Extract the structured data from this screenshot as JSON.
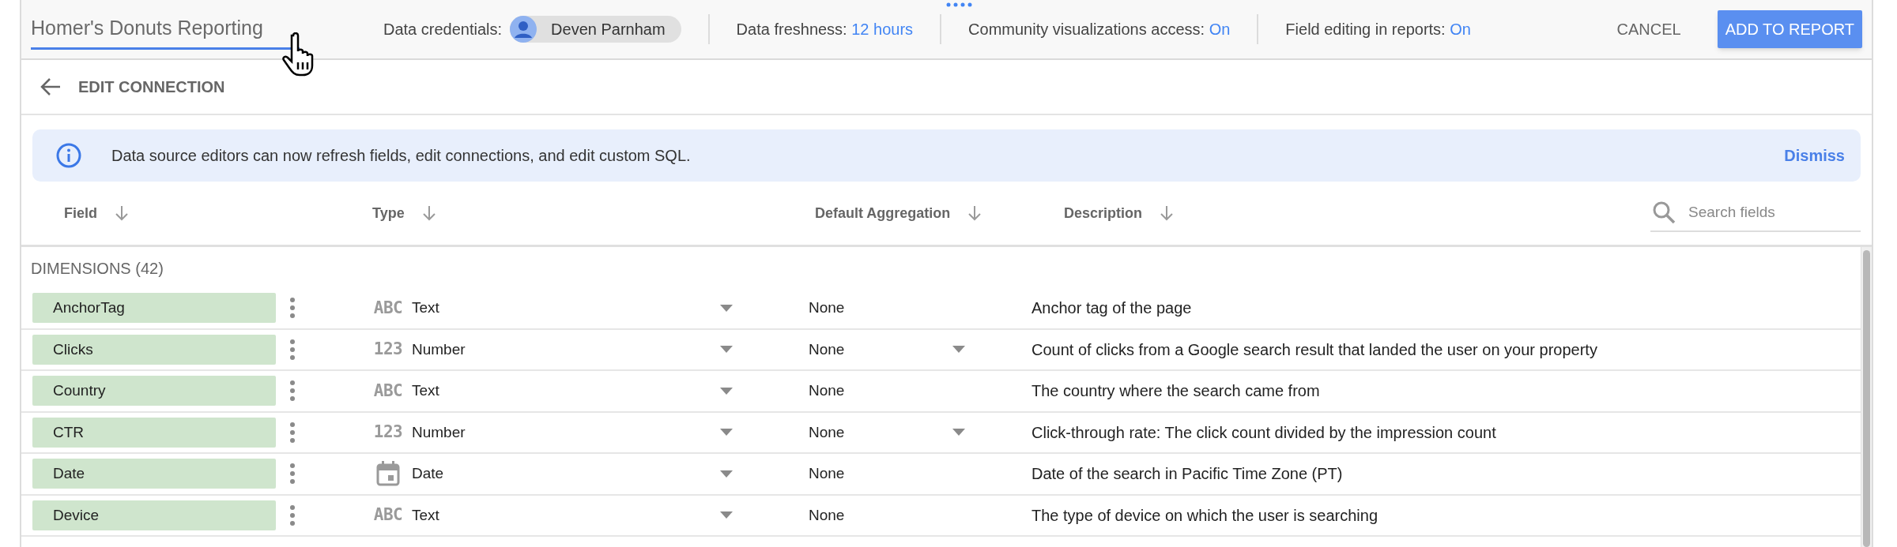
{
  "header": {
    "title": "Homer's Donuts Reporting",
    "credentials": {
      "label": "Data credentials:",
      "user": "Deven Parnham"
    },
    "settings": [
      {
        "label": "Data freshness:",
        "value": "12 hours"
      },
      {
        "label": "Community visualizations access:",
        "value": "On"
      },
      {
        "label": "Field editing in reports:",
        "value": "On"
      }
    ],
    "buttons": [
      {
        "label": "CANCEL",
        "kind": "text"
      },
      {
        "label": "ADD TO REPORT",
        "kind": "primary"
      }
    ]
  },
  "subheader": {
    "title": "EDIT CONNECTION"
  },
  "banner": {
    "message": "Data source editors can now refresh fields, edit connections, and edit custom SQL.",
    "action": "Dismiss"
  },
  "table": {
    "columns": [
      "Field",
      "Type",
      "Default Aggregation",
      "Description"
    ],
    "search": {
      "placeholder": "Search fields"
    },
    "section": "DIMENSIONS (42)",
    "rows": [
      {
        "field": "AnchorTag",
        "kind": "text",
        "type_glyph": "ABC",
        "type": "Text",
        "aggregation": "None",
        "aggregation_menu": false,
        "description": "Anchor tag of the page"
      },
      {
        "field": "Clicks",
        "kind": "number",
        "type_glyph": "123",
        "type": "Number",
        "aggregation": "None",
        "aggregation_menu": true,
        "description": "Count of clicks from a Google search result that landed the user on your property"
      },
      {
        "field": "Country",
        "kind": "text",
        "type_glyph": "ABC",
        "type": "Text",
        "aggregation": "None",
        "aggregation_menu": false,
        "description": "The country where the search came from"
      },
      {
        "field": "CTR",
        "kind": "number",
        "type_glyph": "123",
        "type": "Number",
        "aggregation": "None",
        "aggregation_menu": true,
        "description": "Click-through rate: The click count divided by the impression count"
      },
      {
        "field": "Date",
        "kind": "date",
        "type": "Date",
        "aggregation": "None",
        "aggregation_menu": false,
        "description": "Date of the search in Pacific Time Zone (PT)"
      },
      {
        "field": "Device",
        "kind": "text",
        "type_glyph": "ABC",
        "type": "Text",
        "aggregation": "None",
        "aggregation_menu": false,
        "description": "The type of device on which the user is searching"
      }
    ]
  }
}
